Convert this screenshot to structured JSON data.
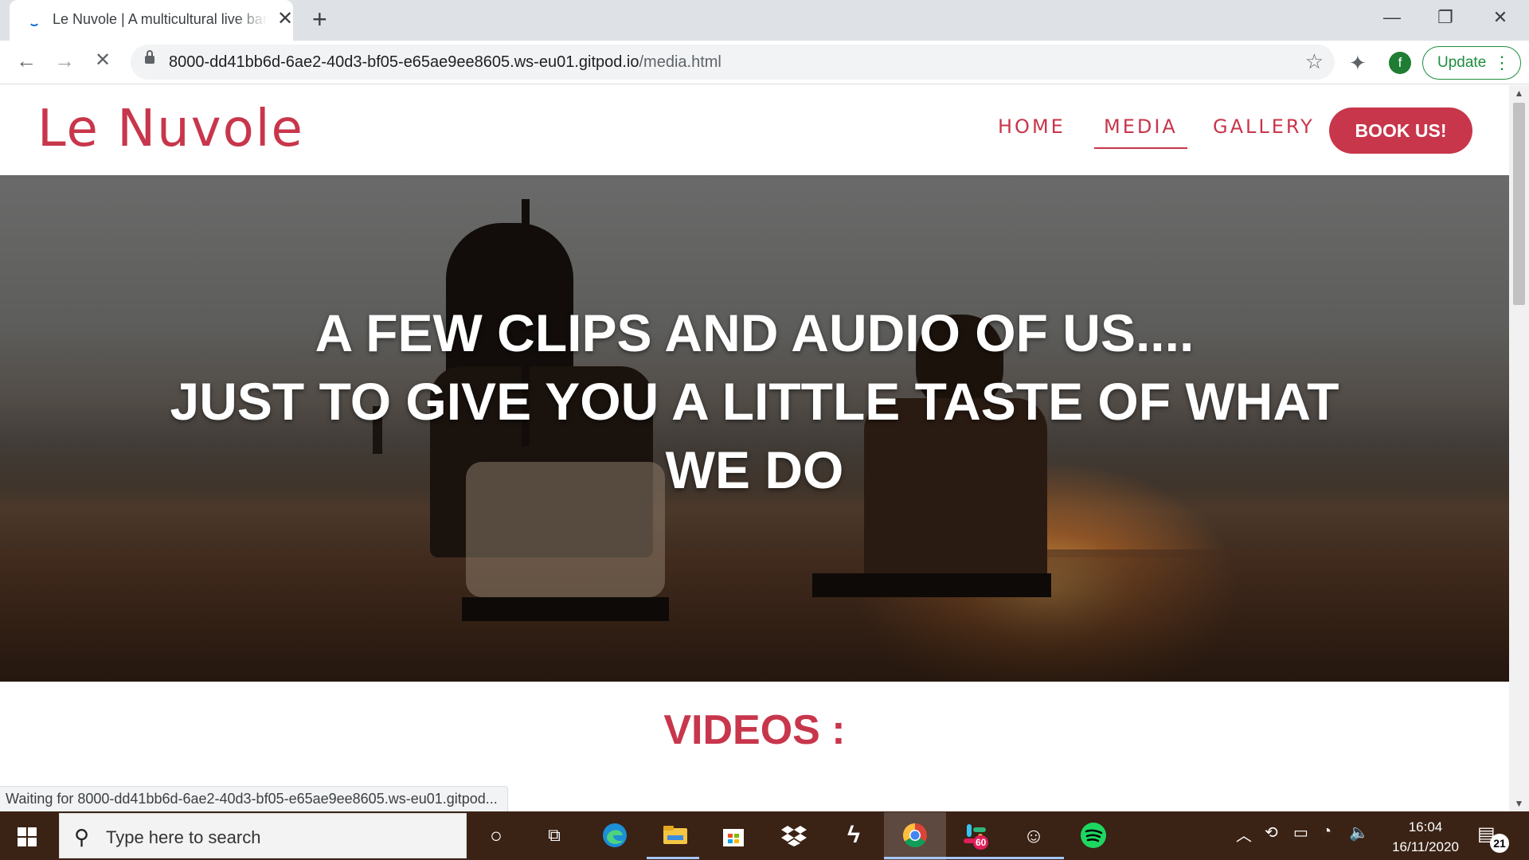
{
  "browser": {
    "tab_title": "Le Nuvole | A multicultural live band",
    "tab_close": "✕",
    "new_tab": "+",
    "window_controls": {
      "minimize": "—",
      "restore": "❐",
      "close": "✕"
    },
    "back": "←",
    "forward": "→",
    "stop": "✕",
    "url_host": "8000-dd41bb6d-6ae2-40d3-bf05-e65ae9ee8605.ws-eu01.gitpod.io",
    "url_path": "/media.html",
    "star": "☆",
    "extensions_icon": "✦",
    "profile_initial": "f",
    "update_label": "Update",
    "menu_dots": "⋮",
    "status_text": "Waiting for 8000-dd41bb6d-6ae2-40d3-bf05-e65ae9ee8605.ws-eu01.gitpod..."
  },
  "site": {
    "brand": "Le Nuvole",
    "nav": {
      "home": "HOME",
      "media": "MEDIA",
      "gallery": "GALLERY",
      "book": "BOOK US!"
    },
    "active_nav": "media",
    "hero_line1": "A FEW CLIPS AND AUDIO OF US....",
    "hero_line2": "JUST TO GIVE YOU A LITTLE TASTE OF WHAT WE DO",
    "videos_heading": "VIDEOS :",
    "accent_color": "#c8364b"
  },
  "taskbar": {
    "search_placeholder": "Type here to search",
    "time": "16:04",
    "date": "16/11/2020",
    "slack_badge": "60",
    "notification_count": "21",
    "apps": [
      "cortana",
      "task-view",
      "edge",
      "file-explorer",
      "store",
      "dropbox",
      "app-s",
      "chrome",
      "slack",
      "smiley-app",
      "spotify"
    ]
  }
}
